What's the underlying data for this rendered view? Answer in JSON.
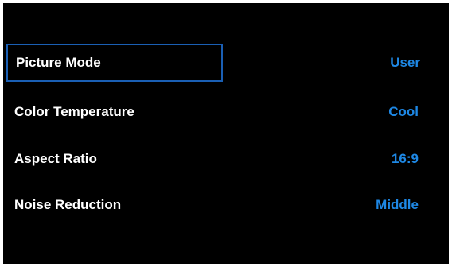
{
  "colors": {
    "background": "#000000",
    "label": "#ffffff",
    "value": "#1e88e5",
    "selection_border": "#1a5fb4"
  },
  "menu": {
    "items": [
      {
        "label": "Picture Mode",
        "value": "User",
        "selected": true
      },
      {
        "label": "Color Temperature",
        "value": "Cool",
        "selected": false
      },
      {
        "label": "Aspect Ratio",
        "value": "16:9",
        "selected": false
      },
      {
        "label": "Noise Reduction",
        "value": "Middle",
        "selected": false
      }
    ]
  }
}
